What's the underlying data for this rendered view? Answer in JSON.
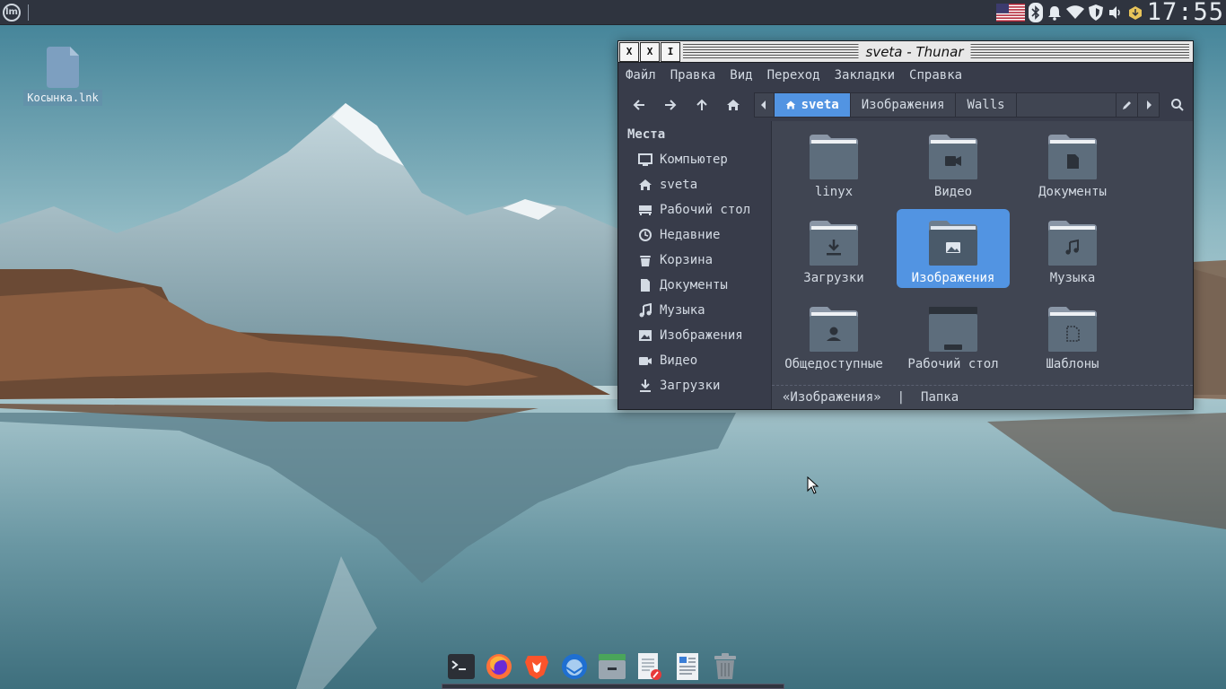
{
  "panel": {
    "menu_icon": "mint-logo-icon",
    "clock": "17:55",
    "tray_icons": [
      "us-flag-icon",
      "bluetooth-icon",
      "bell-icon",
      "wifi-icon",
      "shield-icon",
      "volume-icon",
      "updates-icon"
    ]
  },
  "desktop": {
    "icons": [
      {
        "label": "Косынка.lnk",
        "icon": "file-icon"
      }
    ]
  },
  "thunar": {
    "title": "sveta - Thunar",
    "titlebar_buttons": [
      "X",
      "X",
      "I"
    ],
    "menu": [
      "Файл",
      "Правка",
      "Вид",
      "Переход",
      "Закладки",
      "Справка"
    ],
    "toolbar_icons": [
      "back-icon",
      "forward-icon",
      "up-icon",
      "home-icon"
    ],
    "path": [
      {
        "label": "sveta",
        "icon": "home-icon",
        "active": true
      },
      {
        "label": "Изображения",
        "active": false
      },
      {
        "label": "Walls",
        "active": false
      }
    ],
    "sidebar": {
      "title": "Места",
      "items": [
        {
          "label": "Компьютер",
          "icon": "monitor-icon"
        },
        {
          "label": "sveta",
          "icon": "home-icon"
        },
        {
          "label": "Рабочий стол",
          "icon": "desktop-icon"
        },
        {
          "label": "Недавние",
          "icon": "clock-icon"
        },
        {
          "label": "Корзина",
          "icon": "trash-icon"
        },
        {
          "label": "Документы",
          "icon": "document-icon"
        },
        {
          "label": "Музыка",
          "icon": "music-icon"
        },
        {
          "label": "Изображения",
          "icon": "image-icon"
        },
        {
          "label": "Видео",
          "icon": "video-icon"
        },
        {
          "label": "Загрузки",
          "icon": "download-icon"
        }
      ]
    },
    "files": [
      {
        "label": "linyx",
        "icon": "folder-icon",
        "selected": false
      },
      {
        "label": "Видео",
        "icon": "folder-video-icon",
        "selected": false
      },
      {
        "label": "Документы",
        "icon": "folder-documents-icon",
        "selected": false
      },
      {
        "label": "Загрузки",
        "icon": "folder-download-icon",
        "selected": false
      },
      {
        "label": "Изображения",
        "icon": "folder-pictures-icon",
        "selected": true
      },
      {
        "label": "Музыка",
        "icon": "folder-music-icon",
        "selected": false
      },
      {
        "label": "Общедоступные",
        "icon": "folder-public-icon",
        "selected": false
      },
      {
        "label": "Рабочий стол",
        "icon": "folder-desktop-icon",
        "selected": false
      },
      {
        "label": "Шаблоны",
        "icon": "folder-templates-icon",
        "selected": false
      }
    ],
    "status": {
      "name": "«Изображения»",
      "separator": "|",
      "type": "Папка"
    }
  },
  "dock": {
    "apps": [
      "terminal-icon",
      "firefox-icon",
      "brave-icon",
      "thunderbird-icon",
      "file-manager-icon",
      "text-editor-icon",
      "notes-icon",
      "trash-icon"
    ]
  },
  "colors": {
    "accent": "#5294e2",
    "window_bg": "#383c4a",
    "panel_bg": "#2f343f",
    "text": "#d3dae3"
  }
}
